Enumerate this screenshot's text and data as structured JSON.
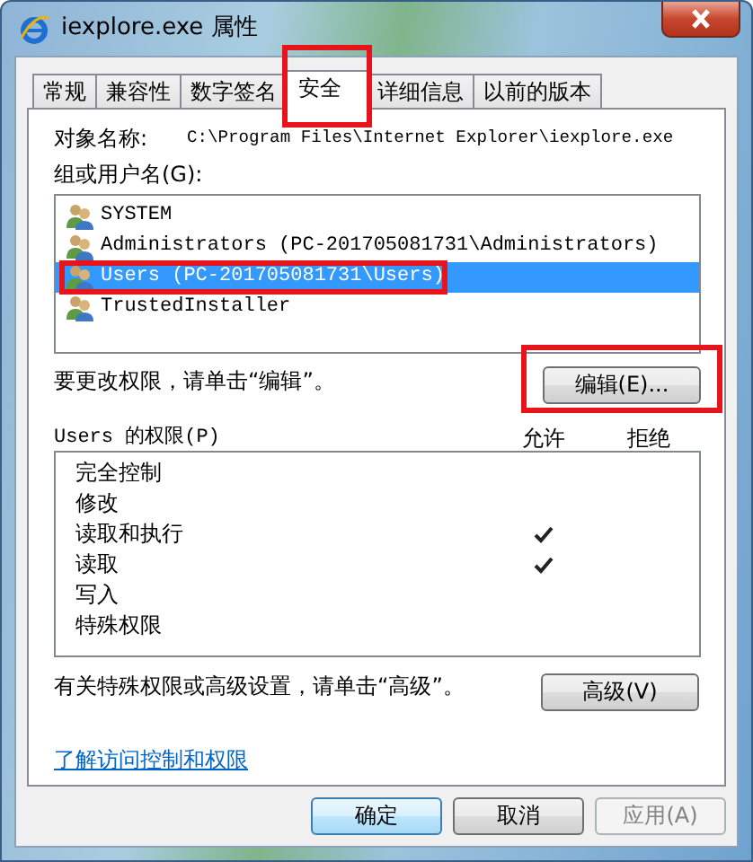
{
  "window": {
    "title": "iexplore.exe 属性"
  },
  "tabs": [
    {
      "label": "常规",
      "selected": false,
      "highlighted": false
    },
    {
      "label": "兼容性",
      "selected": false,
      "highlighted": false
    },
    {
      "label": "数字签名",
      "selected": false,
      "highlighted": false
    },
    {
      "label": "安全",
      "selected": true,
      "highlighted": true
    },
    {
      "label": "详细信息",
      "selected": false,
      "highlighted": false
    },
    {
      "label": "以前的版本",
      "selected": false,
      "highlighted": false
    }
  ],
  "object_name": {
    "label": "对象名称:",
    "value": "C:\\Program Files\\Internet Explorer\\iexplore.exe"
  },
  "groups": {
    "label": "组或用户名(G):",
    "items": [
      {
        "name": "SYSTEM",
        "selected": false,
        "highlighted": false
      },
      {
        "name": "Administrators (PC-201705081731\\Administrators)",
        "selected": false,
        "highlighted": false
      },
      {
        "name": "Users (PC-201705081731\\Users)",
        "selected": true,
        "highlighted": true
      },
      {
        "name": "TrustedInstaller",
        "selected": false,
        "highlighted": false
      }
    ]
  },
  "edit_hint": "要更改权限，请单击“编辑”。",
  "edit_button": {
    "label": "编辑(E)...",
    "highlighted": true
  },
  "permissions": {
    "label": "Users 的权限(P)",
    "allow_header": "允许",
    "deny_header": "拒绝",
    "rows": [
      {
        "name": "完全控制",
        "allow": false,
        "deny": false
      },
      {
        "name": "修改",
        "allow": false,
        "deny": false
      },
      {
        "name": "读取和执行",
        "allow": true,
        "deny": false
      },
      {
        "name": "读取",
        "allow": true,
        "deny": false
      },
      {
        "name": "写入",
        "allow": false,
        "deny": false
      },
      {
        "name": "特殊权限",
        "allow": false,
        "deny": false
      }
    ]
  },
  "advanced_hint": "有关特殊权限或高级设置，请单击“高级”。",
  "advanced_button": {
    "label": "高级(V)"
  },
  "help_link": "了解访问控制和权限",
  "buttons": [
    {
      "label": "确定",
      "default": true,
      "disabled": false
    },
    {
      "label": "取消",
      "default": false,
      "disabled": false
    },
    {
      "label": "应用(A)",
      "default": false,
      "disabled": true
    }
  ]
}
